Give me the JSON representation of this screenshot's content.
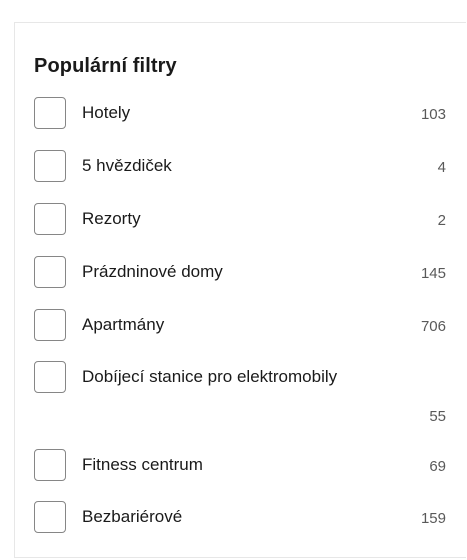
{
  "section": {
    "title": "Populární filtry"
  },
  "filters": [
    {
      "label": "Hotely",
      "count": "103"
    },
    {
      "label": "5 hvězdiček",
      "count": "4"
    },
    {
      "label": "Rezorty",
      "count": "2"
    },
    {
      "label": "Prázdninové domy",
      "count": "145"
    },
    {
      "label": "Apartmány",
      "count": "706"
    },
    {
      "label": "Dobíjecí stanice pro elektromobily",
      "count": "55"
    },
    {
      "label": "Fitness centrum",
      "count": "69"
    },
    {
      "label": "Bezbariérové",
      "count": "159"
    }
  ]
}
